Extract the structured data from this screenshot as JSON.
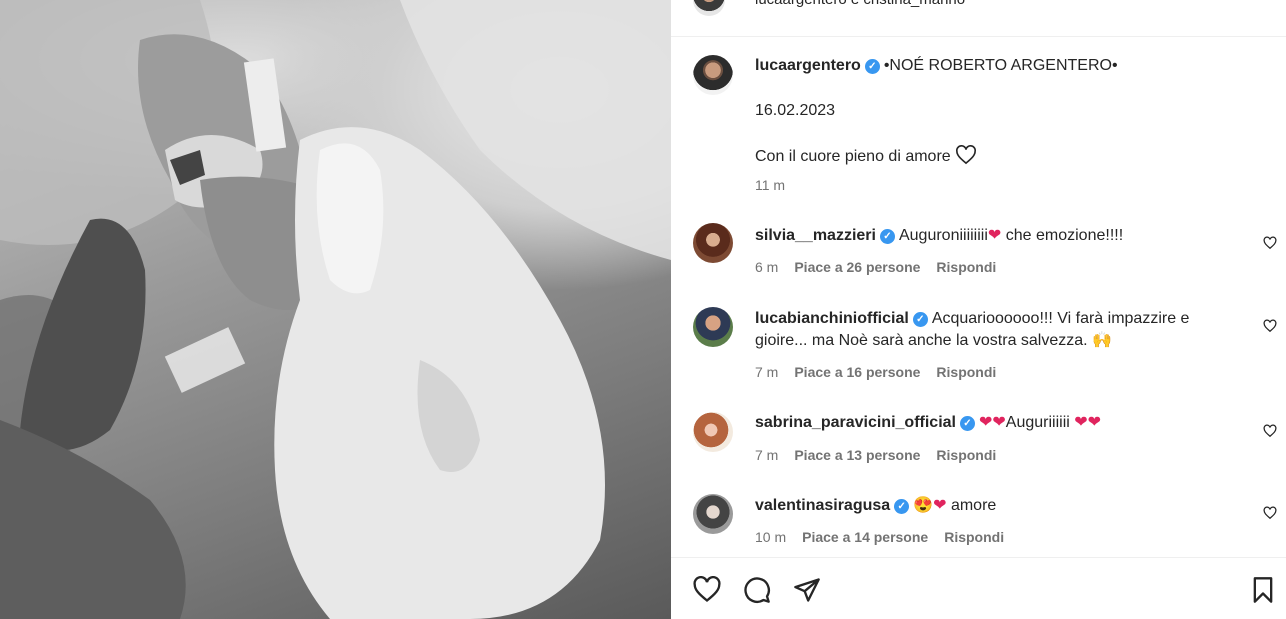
{
  "header": {
    "visible_text": "lucaargentero e cristina_marino"
  },
  "post": {
    "author": "lucaargentero",
    "caption_title": "•NOÉ ROBERTO ARGENTERO•",
    "caption_date": "16.02.2023",
    "caption_text": "Con il cuore pieno di amore",
    "time": "11 m"
  },
  "comments": [
    {
      "user": "silvia__mazzieri",
      "text_a": "Auguroniiiiiiii",
      "text_b": " che emozione!!!!",
      "time": "6 m",
      "likes": "Piace a 26 persone",
      "reply": "Rispondi"
    },
    {
      "user": "lucabianchiniofficial",
      "text_line1": "Acquarioooooo!!! Vi farà impazzire e",
      "text_line2": "gioire... ma Noè sarà anche la vostra salvezza.",
      "emoji": "🙌",
      "time": "7 m",
      "likes": "Piace a 16 persone",
      "reply": "Rispondi"
    },
    {
      "user": "sabrina_paravicini_official",
      "text": "Auguriiiiii",
      "time": "7 m",
      "likes": "Piace a 13 persone",
      "reply": "Rispondi"
    },
    {
      "user": "valentinasiragusa",
      "emoji": "😍",
      "text": " amore",
      "time": "10 m",
      "likes": "Piace a 14 persone",
      "reply": "Rispondi"
    }
  ],
  "icons": {
    "like": "heart-icon",
    "comment": "comment-bubble-icon",
    "share": "paper-plane-icon",
    "save": "bookmark-icon",
    "verified": "verified-badge-icon",
    "comment_like": "small-heart-icon"
  },
  "colors": {
    "verified": "#3897f0",
    "heart_red": "#e0245e",
    "meta_gray": "#737373",
    "text": "#262626"
  }
}
